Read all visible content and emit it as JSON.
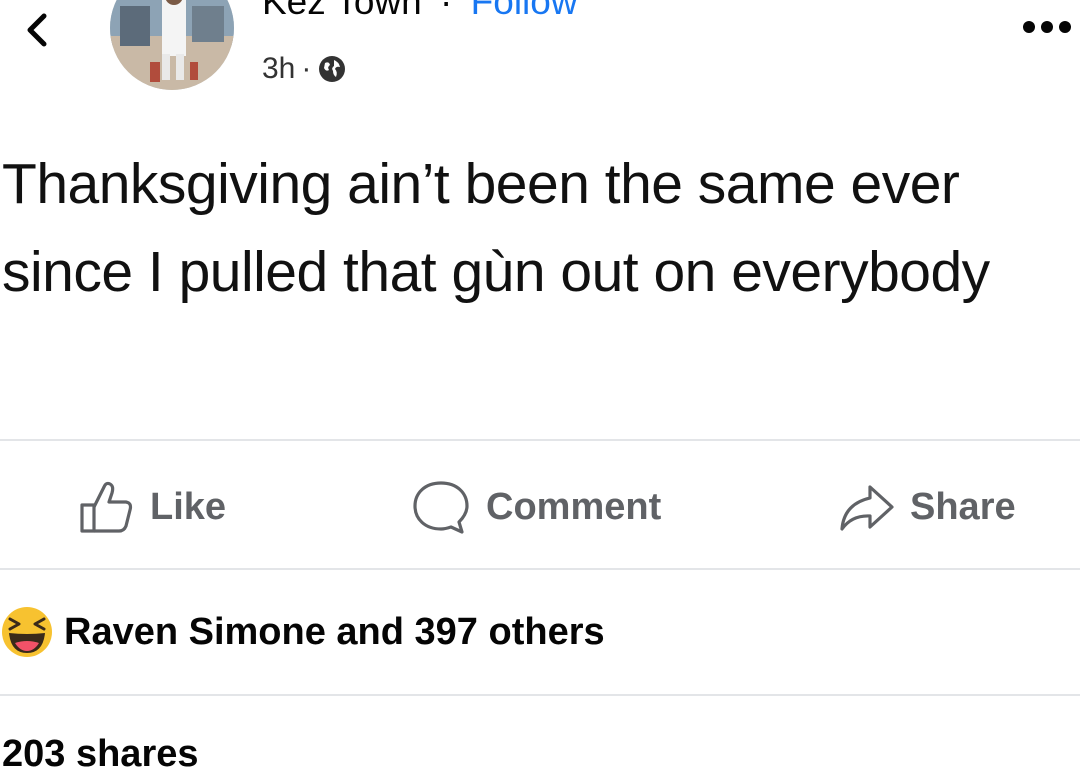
{
  "header": {
    "author_name": "Kez Town",
    "separator": "·",
    "follow_label": "Follow",
    "time_ago": "3h",
    "meta_separator": "·",
    "privacy_icon": "globe-icon",
    "back_icon": "chevron-left-icon",
    "more_icon": "more-horizontal-icon"
  },
  "post": {
    "text": "Thanksgiving ain’t been the same ever since I pulled that gùn out on everybody"
  },
  "actions": [
    {
      "label": "Like",
      "icon": "thumbs-up-icon"
    },
    {
      "label": "Comment",
      "icon": "comment-bubble-icon"
    },
    {
      "label": "Share",
      "icon": "share-arrow-icon"
    }
  ],
  "reactions": {
    "emoji_icon": "laughing-emoji-icon",
    "text": "Raven Simone and 397 others"
  },
  "shares": {
    "text": "203 shares"
  },
  "colors": {
    "link_blue": "#1877f2",
    "action_gray": "#606266",
    "divider": "#e3e5e8",
    "emoji_yellow": "#f7c230"
  }
}
